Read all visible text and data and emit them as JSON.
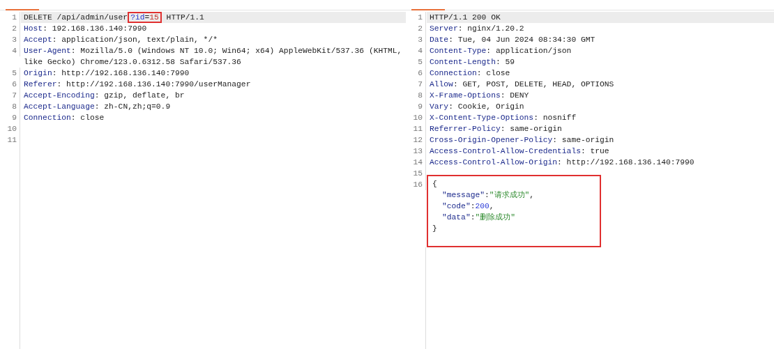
{
  "request": {
    "lines": [
      {
        "n": "1",
        "current": true,
        "tokens": [
          {
            "kind": "text",
            "t": "DELETE /api/admin/user"
          },
          {
            "kind": "boxed",
            "parts": [
              {
                "kind": "pname",
                "t": "?id"
              },
              {
                "kind": "text",
                "t": "="
              },
              {
                "kind": "pvalue",
                "t": "15"
              }
            ]
          },
          {
            "kind": "text",
            "t": " HTTP/1.1"
          }
        ]
      },
      {
        "n": "2",
        "current": false,
        "tokens": [
          {
            "kind": "key",
            "t": "Host"
          },
          {
            "kind": "text",
            "t": ": 192.168.136.140:7990"
          }
        ]
      },
      {
        "n": "3",
        "current": false,
        "tokens": [
          {
            "kind": "key",
            "t": "Accept"
          },
          {
            "kind": "text",
            "t": ": application/json, text/plain, */*"
          }
        ]
      },
      {
        "n": "4",
        "current": false,
        "tokens": [
          {
            "kind": "key",
            "t": "User-Agent"
          },
          {
            "kind": "text",
            "t": ": Mozilla/5.0 (Windows NT 10.0; Win64; x64) AppleWebKit/537.36 (KHTML, like Gecko) Chrome/123.0.6312.58 Safari/537.36"
          }
        ]
      },
      {
        "n": "5",
        "current": false,
        "tokens": [
          {
            "kind": "key",
            "t": "Origin"
          },
          {
            "kind": "text",
            "t": ": http://192.168.136.140:7990"
          }
        ]
      },
      {
        "n": "6",
        "current": false,
        "tokens": [
          {
            "kind": "key",
            "t": "Referer"
          },
          {
            "kind": "text",
            "t": ": http://192.168.136.140:7990/userManager"
          }
        ]
      },
      {
        "n": "7",
        "current": false,
        "tokens": [
          {
            "kind": "key",
            "t": "Accept-Encoding"
          },
          {
            "kind": "text",
            "t": ": gzip, deflate, br"
          }
        ]
      },
      {
        "n": "8",
        "current": false,
        "tokens": [
          {
            "kind": "key",
            "t": "Accept-Language"
          },
          {
            "kind": "text",
            "t": ": zh-CN,zh;q=0.9"
          }
        ]
      },
      {
        "n": "9",
        "current": false,
        "tokens": [
          {
            "kind": "key",
            "t": "Connection"
          },
          {
            "kind": "text",
            "t": ": close"
          }
        ]
      },
      {
        "n": "10",
        "current": false
      },
      {
        "n": "11",
        "current": false
      }
    ]
  },
  "response": {
    "lines": [
      {
        "n": "1",
        "current": true,
        "tokens": [
          {
            "kind": "text",
            "t": "HTTP/1.1 200 OK"
          }
        ]
      },
      {
        "n": "2",
        "current": false,
        "tokens": [
          {
            "kind": "key",
            "t": "Server"
          },
          {
            "kind": "text",
            "t": ": nginx/1.20.2"
          }
        ]
      },
      {
        "n": "3",
        "current": false,
        "tokens": [
          {
            "kind": "key",
            "t": "Date"
          },
          {
            "kind": "text",
            "t": ": Tue, 04 Jun 2024 08:34:30 GMT"
          }
        ]
      },
      {
        "n": "4",
        "current": false,
        "tokens": [
          {
            "kind": "key",
            "t": "Content-Type"
          },
          {
            "kind": "text",
            "t": ": application/json"
          }
        ]
      },
      {
        "n": "5",
        "current": false,
        "tokens": [
          {
            "kind": "key",
            "t": "Content-Length"
          },
          {
            "kind": "text",
            "t": ": 59"
          }
        ]
      },
      {
        "n": "6",
        "current": false,
        "tokens": [
          {
            "kind": "key",
            "t": "Connection"
          },
          {
            "kind": "text",
            "t": ": close"
          }
        ]
      },
      {
        "n": "7",
        "current": false,
        "tokens": [
          {
            "kind": "key",
            "t": "Allow"
          },
          {
            "kind": "text",
            "t": ": GET, POST, DELETE, HEAD, OPTIONS"
          }
        ]
      },
      {
        "n": "8",
        "current": false,
        "tokens": [
          {
            "kind": "key",
            "t": "X-Frame-Options"
          },
          {
            "kind": "text",
            "t": ": DENY"
          }
        ]
      },
      {
        "n": "9",
        "current": false,
        "tokens": [
          {
            "kind": "key",
            "t": "Vary"
          },
          {
            "kind": "text",
            "t": ": Cookie, Origin"
          }
        ]
      },
      {
        "n": "10",
        "current": false,
        "tokens": [
          {
            "kind": "key",
            "t": "X-Content-Type-Options"
          },
          {
            "kind": "text",
            "t": ": nosniff"
          }
        ]
      },
      {
        "n": "11",
        "current": false,
        "tokens": [
          {
            "kind": "key",
            "t": "Referrer-Policy"
          },
          {
            "kind": "text",
            "t": ": same-origin"
          }
        ]
      },
      {
        "n": "12",
        "current": false,
        "tokens": [
          {
            "kind": "key",
            "t": "Cross-Origin-Opener-Policy"
          },
          {
            "kind": "text",
            "t": ": same-origin"
          }
        ]
      },
      {
        "n": "13",
        "current": false,
        "tokens": [
          {
            "kind": "key",
            "t": "Access-Control-Allow-Credentials"
          },
          {
            "kind": "text",
            "t": ": true"
          }
        ]
      },
      {
        "n": "14",
        "current": false,
        "tokens": [
          {
            "kind": "key",
            "t": "Access-Control-Allow-Origin"
          },
          {
            "kind": "text",
            "t": ": http://192.168.136.140:7990"
          }
        ]
      },
      {
        "n": "15",
        "current": false
      }
    ],
    "body": {
      "n": "16",
      "boxed": true,
      "rows": [
        {
          "indent": false,
          "tokens": [
            {
              "kind": "text",
              "t": "{"
            }
          ]
        },
        {
          "indent": true,
          "tokens": [
            {
              "kind": "jkey",
              "t": "\"message\""
            },
            {
              "kind": "text",
              "t": ":"
            },
            {
              "kind": "str",
              "t": "\"请求成功\""
            },
            {
              "kind": "text",
              "t": ","
            }
          ]
        },
        {
          "indent": true,
          "tokens": [
            {
              "kind": "jkey",
              "t": "\"code\""
            },
            {
              "kind": "text",
              "t": ":"
            },
            {
              "kind": "num",
              "t": "200"
            },
            {
              "kind": "text",
              "t": ","
            }
          ]
        },
        {
          "indent": true,
          "tokens": [
            {
              "kind": "jkey",
              "t": "\"data\""
            },
            {
              "kind": "text",
              "t": ":"
            },
            {
              "kind": "str",
              "t": "\"删除成功\""
            }
          ]
        },
        {
          "indent": false,
          "tokens": [
            {
              "kind": "text",
              "t": "}"
            }
          ]
        }
      ]
    }
  }
}
